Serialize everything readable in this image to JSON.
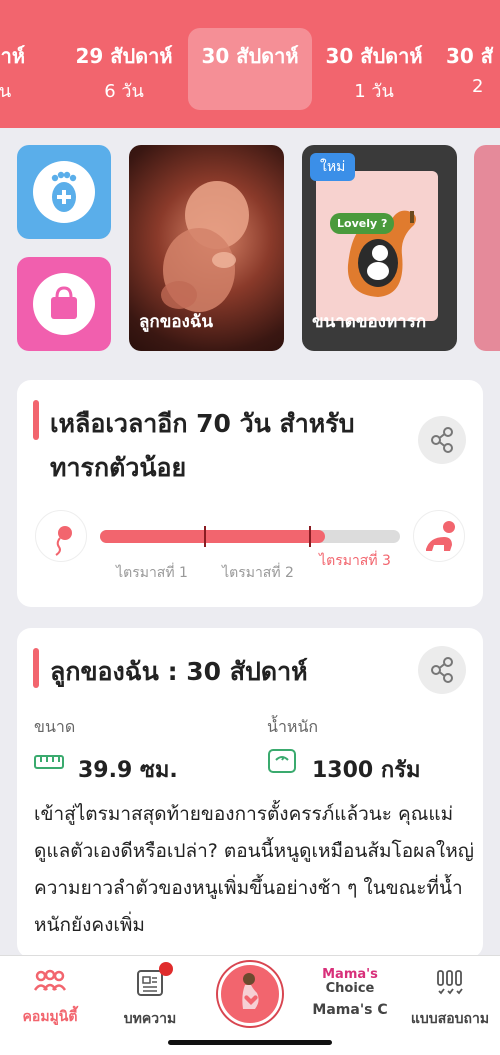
{
  "weeks": [
    {
      "week": "ปดาห์",
      "days": "วัน"
    },
    {
      "week": "29 สัปดาห์",
      "days": "6 วัน"
    },
    {
      "week": "30 สัปดาห์",
      "days": ""
    },
    {
      "week": "30 สัปดาห์",
      "days": "1 วัน"
    },
    {
      "week": "30 สั",
      "days": "2"
    }
  ],
  "cards": {
    "fetus_label": "ลูกของฉัน",
    "size_label": "ขนาดของทารก",
    "new_badge": "ใหม่",
    "lovely_text": "Lovely ?"
  },
  "countdown": {
    "title": "เหลือเวลาอีก 70 วัน สำหรับทารกตัวน้อย",
    "progress_fraction": 0.75,
    "trimesters": [
      "ไตรมาสที่ 1",
      "ไตรมาสที่ 2",
      "ไตรมาสที่ 3"
    ]
  },
  "baby": {
    "title": "ลูกของฉัน :  30 สัปดาห์",
    "size_label": "ขนาด",
    "size_value": "39.9 ซม.",
    "weight_label": "น้ำหนัก",
    "weight_value": "1300 กรัม",
    "description": "เข้าสู่ไตรมาสสุดท้ายของการตั้งครรภ์แล้วนะ คุณแม่ดูแลตัวเองดีหรือเปล่า? ตอนนี้หนูดูเหมือนส้มโอผลใหญ่ ความยาวลำตัวของหนูเพิ่มขึ้นอย่างช้า ๆ ในขณะที่น้ำหนักยังคงเพิ่ม"
  },
  "nav": {
    "community": "คอมมูนิตี้",
    "articles": "บทความ",
    "mamas_choice_logo_1": "Mama's",
    "mamas_choice_logo_2": "Choice",
    "mamas_choice": "Mama's C",
    "survey": "แบบสอบถาม"
  },
  "colors": {
    "accent": "#f2656e",
    "blue_tile": "#5aaeea",
    "pink_tile": "#f15fae",
    "badge_blue": "#3b8fe8"
  }
}
